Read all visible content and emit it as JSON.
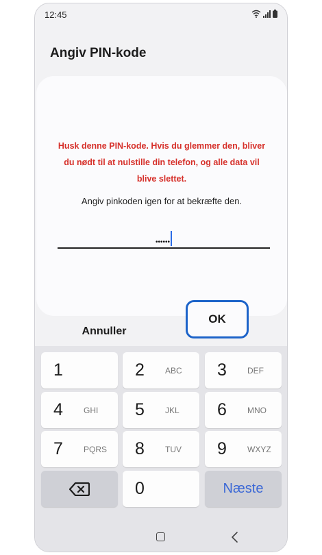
{
  "status_bar": {
    "time": "12:45"
  },
  "page": {
    "title": "Angiv PIN-kode"
  },
  "dialog": {
    "warning_lines": [
      "Husk denne PIN-kode. Hvis du glemmer den, bliver",
      "du nødt til at nulstille din telefon, og alle data vil",
      "blive slettet."
    ],
    "instruction": "Angiv pinkoden igen for at bekræfte den.",
    "pin_masked": "••••••",
    "cancel_label": "Annuller",
    "ok_label": "OK"
  },
  "keypad": {
    "keys": [
      {
        "digit": "1",
        "letters": ""
      },
      {
        "digit": "2",
        "letters": "ABC"
      },
      {
        "digit": "3",
        "letters": "DEF"
      },
      {
        "digit": "4",
        "letters": "GHI"
      },
      {
        "digit": "5",
        "letters": "JKL"
      },
      {
        "digit": "6",
        "letters": "MNO"
      },
      {
        "digit": "7",
        "letters": "PQRS"
      },
      {
        "digit": "8",
        "letters": "TUV"
      },
      {
        "digit": "9",
        "letters": "WXYZ"
      }
    ],
    "zero": "0",
    "next_label": "Næste",
    "backspace_icon": "backspace-icon"
  },
  "colors": {
    "warning": "#d6302a",
    "accent": "#1c63c9",
    "next_key_text": "#3b68d6"
  }
}
